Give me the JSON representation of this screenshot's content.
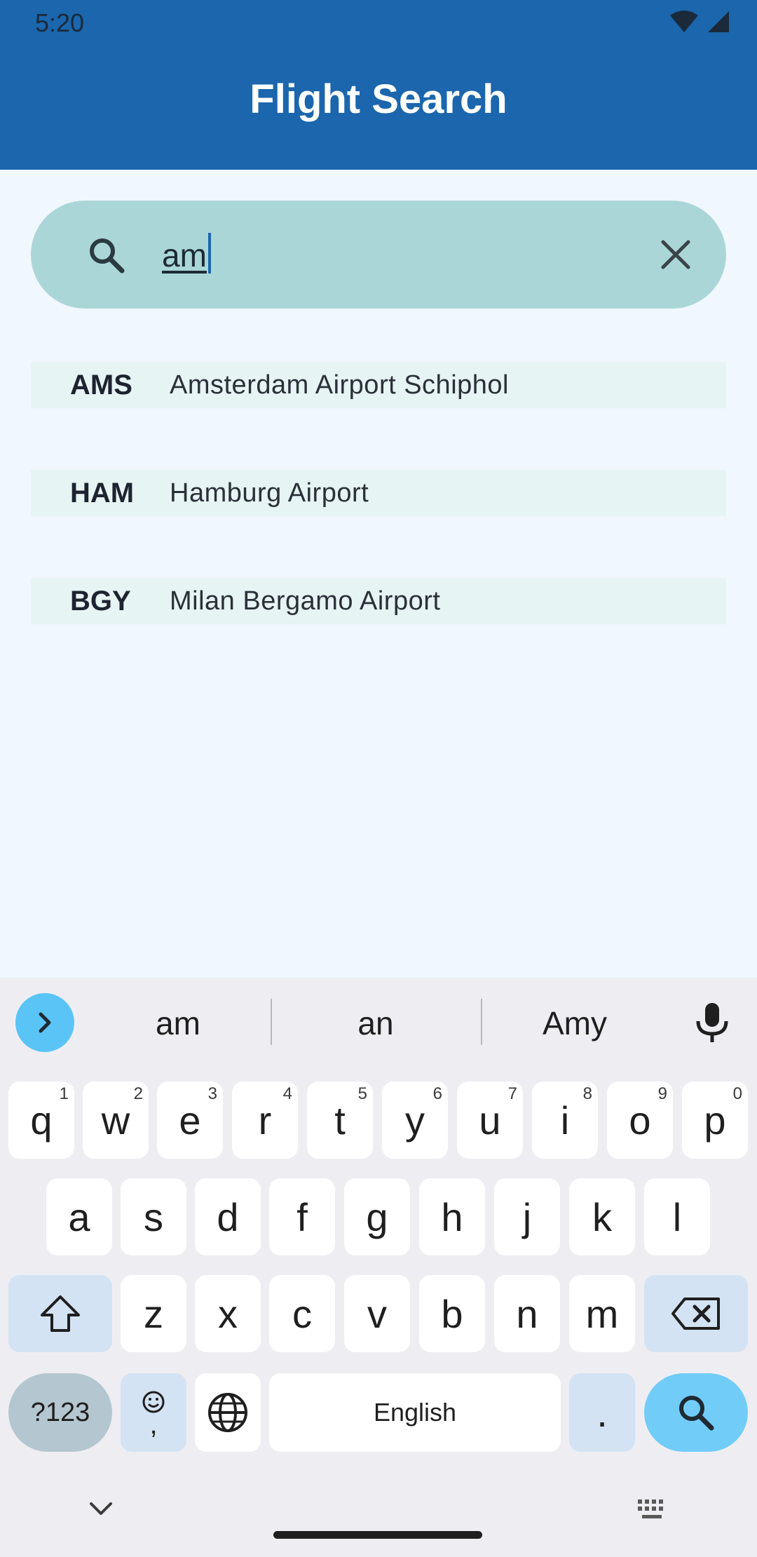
{
  "status_bar": {
    "time": "5:20"
  },
  "app_bar": {
    "title": "Flight Search"
  },
  "search": {
    "value": "am"
  },
  "results": [
    {
      "code": "AMS",
      "name": "Amsterdam Airport Schiphol"
    },
    {
      "code": "HAM",
      "name": "Hamburg Airport"
    },
    {
      "code": "BGY",
      "name": "Milan Bergamo Airport"
    }
  ],
  "keyboard": {
    "suggestions": [
      "am",
      "an",
      "Amy"
    ],
    "row1": [
      {
        "key": "q",
        "hint": "1"
      },
      {
        "key": "w",
        "hint": "2"
      },
      {
        "key": "e",
        "hint": "3"
      },
      {
        "key": "r",
        "hint": "4"
      },
      {
        "key": "t",
        "hint": "5"
      },
      {
        "key": "y",
        "hint": "6"
      },
      {
        "key": "u",
        "hint": "7"
      },
      {
        "key": "i",
        "hint": "8"
      },
      {
        "key": "o",
        "hint": "9"
      },
      {
        "key": "p",
        "hint": "0"
      }
    ],
    "row2": [
      "a",
      "s",
      "d",
      "f",
      "g",
      "h",
      "j",
      "k",
      "l"
    ],
    "row3": [
      "z",
      "x",
      "c",
      "v",
      "b",
      "n",
      "m"
    ],
    "symbols_label": "?123",
    "comma_label": ",",
    "space_label": "English",
    "period_label": "."
  },
  "colors": {
    "app_bar": "#1b66ad",
    "search_box": "#abd6d8",
    "result_row": "#e6f4f4",
    "accent_blue": "#5bc4f7"
  }
}
